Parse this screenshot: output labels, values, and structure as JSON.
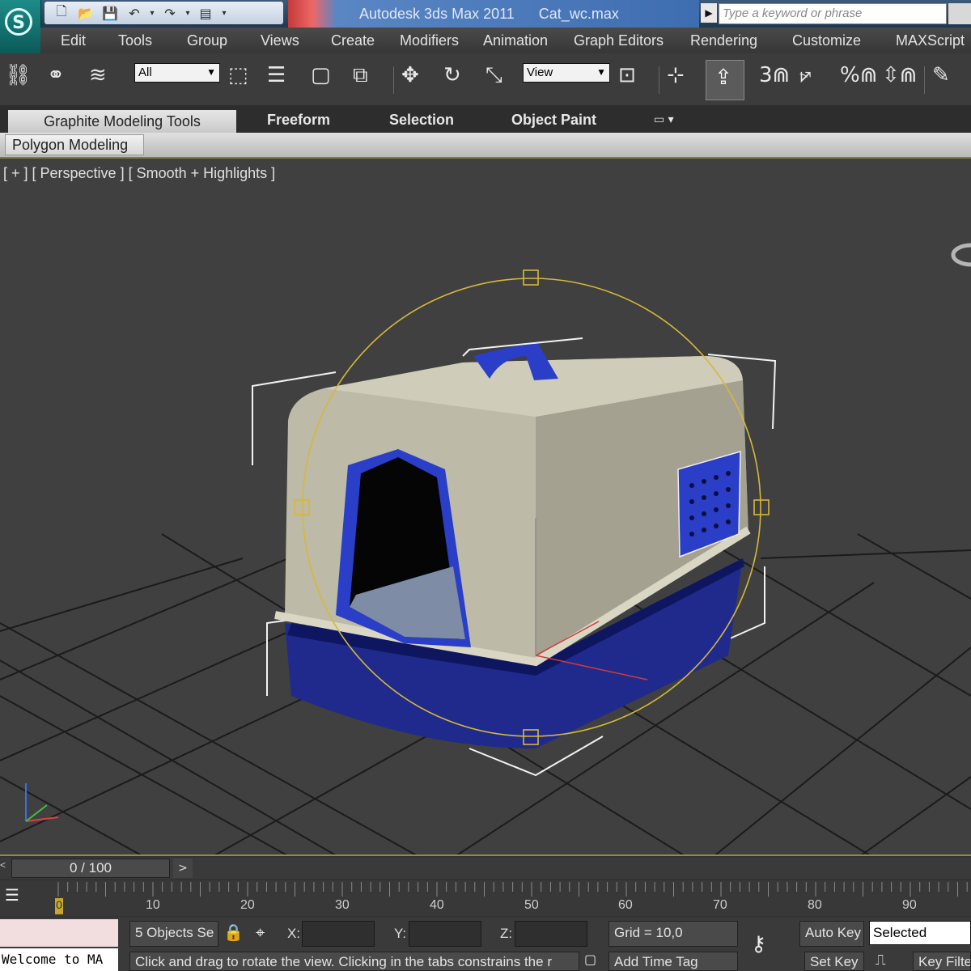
{
  "window": {
    "app_title": "Autodesk 3ds Max  2011",
    "file_name": "Cat_wc.max",
    "search_placeholder": "Type a keyword or phrase"
  },
  "quick_access": {
    "icons": [
      "new-file-icon",
      "open-folder-icon",
      "save-icon",
      "undo-icon",
      "redo-icon",
      "project-folder-icon"
    ]
  },
  "menu": [
    "Edit",
    "Tools",
    "Group",
    "Views",
    "Create",
    "Modifiers",
    "Animation",
    "Graph Editors",
    "Rendering",
    "Customize",
    "MAXScript"
  ],
  "toolbar": {
    "selection_filter": "All",
    "reference_coord": "View",
    "snap_toggle": "3",
    "angle_snap": "",
    "percent_snap": "%",
    "icons": [
      "link-icon",
      "unlink-icon",
      "bind-space-warp-icon",
      "select-object-icon",
      "select-by-name-icon",
      "rectangular-selection-icon",
      "window-crossing-icon",
      "move-icon",
      "rotate-icon",
      "scale-icon",
      "select-and-manipulate-icon",
      "pivot-center-icon",
      "snap-toggle-icon",
      "angle-snap-icon",
      "percent-snap-icon",
      "spinner-snap-icon",
      "edit-named-selections-icon"
    ]
  },
  "ribbon": {
    "tabs": [
      "Graphite Modeling Tools",
      "Freeform",
      "Selection",
      "Object Paint"
    ],
    "panel": "Polygon Modeling"
  },
  "viewport": {
    "label": "[ + ] [ Perspective ] [ Smooth + Highlights ]"
  },
  "timeline": {
    "frame": "0 / 100",
    "prev": "<",
    "next": ">",
    "ticks": [
      "0",
      "10",
      "20",
      "30",
      "40",
      "50",
      "60",
      "70",
      "80",
      "90"
    ]
  },
  "status": {
    "listener_text": "Welcome to MA",
    "selection_info": "5 Objects Se",
    "x_label": "X:",
    "y_label": "Y:",
    "z_label": "Z:",
    "x_value": "",
    "y_value": "",
    "z_value": "",
    "grid": "Grid = 10,0",
    "prompt": "Click and drag to rotate the view.  Clicking in the tabs constrains the r",
    "add_time_tag": "Add Time Tag",
    "auto_key": "Auto Key",
    "set_key": "Set Key",
    "selected": "Selected",
    "key_filters": "Key Filte"
  },
  "colors": {
    "viewport_bg": "#404040",
    "grid_line": "#1b1b1b",
    "selection_gizmo": "#d6b83a",
    "model_shell": "#bdbaa8",
    "model_base": "#1f2a8c",
    "model_trim": "#2a3ec8"
  }
}
